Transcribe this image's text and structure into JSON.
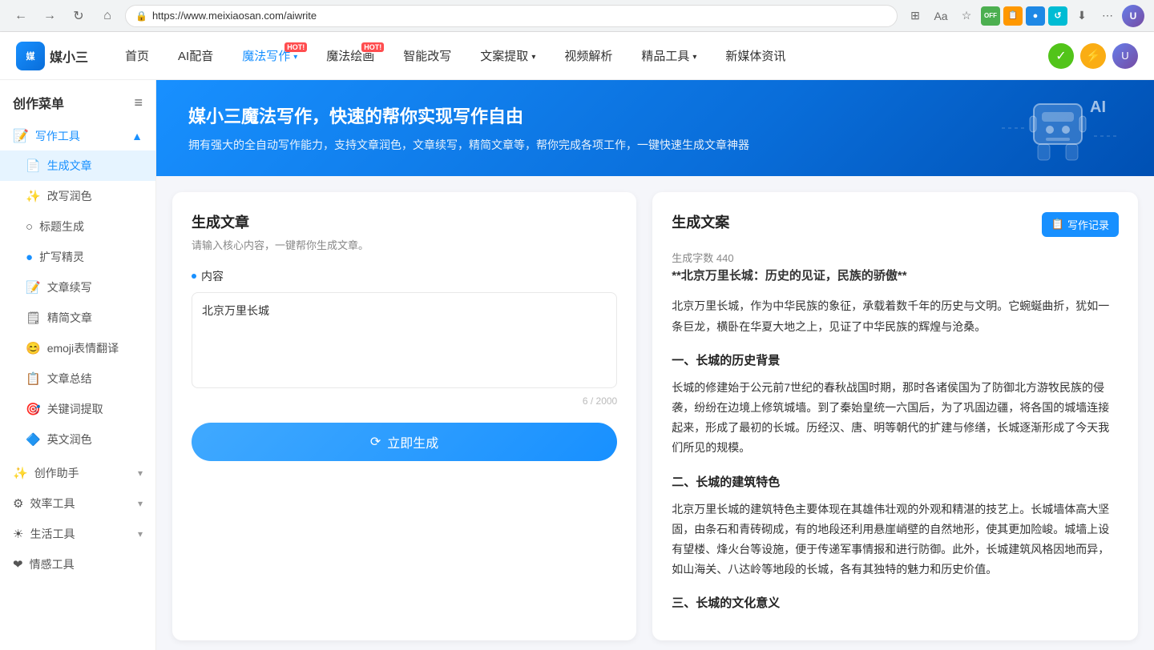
{
  "browser": {
    "url": "https://www.meixiaosan.com/aiwrite",
    "back_label": "←",
    "forward_label": "→",
    "refresh_label": "↻",
    "home_label": "⌂",
    "extensions": [
      {
        "label": "OFF",
        "color": "ext-green"
      },
      {
        "label": "📋",
        "color": "ext-yellow"
      },
      {
        "label": "🔵",
        "color": "ext-blue"
      },
      {
        "label": "🔄",
        "color": "ext-teal"
      },
      {
        "label": "⬇",
        "color": "ext-orange"
      },
      {
        "label": "⋯",
        "color": "ext-purple"
      }
    ],
    "avatar_text": "U"
  },
  "nav": {
    "logo_text": "媒小三",
    "logo_icon_text": "媒",
    "items": [
      {
        "label": "首页",
        "hot": false,
        "has_arrow": false
      },
      {
        "label": "AI配音",
        "hot": false,
        "has_arrow": false
      },
      {
        "label": "魔法写作",
        "hot": true,
        "has_arrow": true
      },
      {
        "label": "魔法绘画",
        "hot": true,
        "has_arrow": false
      },
      {
        "label": "智能改写",
        "hot": false,
        "has_arrow": false
      },
      {
        "label": "文案提取",
        "hot": false,
        "has_arrow": true
      },
      {
        "label": "视频解析",
        "hot": false,
        "has_arrow": false
      },
      {
        "label": "精品工具",
        "hot": false,
        "has_arrow": true
      },
      {
        "label": "新媒体资讯",
        "hot": false,
        "has_arrow": false
      }
    ],
    "hot_label": "HOT"
  },
  "sidebar": {
    "title": "创作菜单",
    "menu_icon": "≡",
    "sections": [
      {
        "id": "writing-tools",
        "title": "写作工具",
        "icon": "📝",
        "expanded": true,
        "items": [
          {
            "id": "generate-article",
            "label": "生成文章",
            "icon": "📄",
            "active": true
          },
          {
            "id": "rewrite-polish",
            "label": "改写润色",
            "icon": "✨"
          },
          {
            "id": "title-generate",
            "label": "标题生成",
            "icon": "○"
          },
          {
            "id": "expand-spirit",
            "label": "扩写精灵",
            "icon": "🔵"
          },
          {
            "id": "article-continue",
            "label": "文章续写",
            "icon": "📝"
          },
          {
            "id": "simplify-article",
            "label": "精简文章",
            "icon": "🗒"
          },
          {
            "id": "emoji-translate",
            "label": "emoji表情翻译",
            "icon": "😊"
          },
          {
            "id": "article-summary",
            "label": "文章总结",
            "icon": "📋"
          },
          {
            "id": "keyword-extract",
            "label": "关键词提取",
            "icon": "🎯"
          },
          {
            "id": "english-polish",
            "label": "英文润色",
            "icon": "🟦"
          }
        ]
      },
      {
        "id": "create-assistant",
        "title": "创作助手",
        "icon": "✨",
        "expanded": false,
        "items": []
      },
      {
        "id": "efficiency-tools",
        "title": "效率工具",
        "icon": "⚙",
        "expanded": false,
        "items": []
      },
      {
        "id": "life-tools",
        "title": "生活工具",
        "icon": "☀",
        "expanded": false,
        "items": []
      },
      {
        "id": "emotion-tools",
        "title": "情感工具",
        "icon": "❤",
        "expanded": false,
        "items": []
      }
    ]
  },
  "banner": {
    "title": "媒小三魔法写作，快速的帮你实现写作自由",
    "subtitle": "拥有强大的全自动写作能力，支持文章润色，文章续写，精简文章等，帮你完成各项工作，一键快速生成文章神器"
  },
  "left_card": {
    "title": "生成文章",
    "subtitle": "请输入核心内容，一键帮你生成文章。",
    "content_label": "内容",
    "content_value": "北京万里长城",
    "char_current": "6",
    "char_max": "2000",
    "generate_btn_label": "立即生成",
    "generate_btn_icon": "↻"
  },
  "right_card": {
    "title": "生成文案",
    "word_count_label": "生成字数",
    "word_count_value": "440",
    "record_btn_icon": "📋",
    "record_btn_label": "写作记录",
    "content": [
      {
        "type": "bold_heading",
        "text": "**北京万里长城：历史的见证，民族的骄傲**"
      },
      {
        "type": "paragraph",
        "text": "北京万里长城，作为中华民族的象征，承载着数千年的历史与文明。它蜿蜒曲折，犹如一条巨龙，横卧在华夏大地之上，见证了中华民族的辉煌与沧桑。"
      },
      {
        "type": "section_heading",
        "text": "一、长城的历史背景"
      },
      {
        "type": "paragraph",
        "text": "长城的修建始于公元前7世纪的春秋战国时期，那时各诸侯国为了防御北方游牧民族的侵袭，纷纷在边境上修筑城墙。到了秦始皇统一六国后，为了巩固边疆，将各国的城墙连接起来，形成了最初的长城。历经汉、唐、明等朝代的扩建与修缮，长城逐渐形成了今天我们所见的规模。"
      },
      {
        "type": "section_heading",
        "text": "二、长城的建筑特色"
      },
      {
        "type": "paragraph",
        "text": "北京万里长城的建筑特色主要体现在其雄伟壮观的外观和精湛的技艺上。长城墙体高大坚固，由条石和青砖砌成，有的地段还利用悬崖峭壁的自然地形，使其更加险峻。城墙上设有望楼、烽火台等设施，便于传递军事情报和进行防御。此外，长城建筑风格因地而异，如山海关、八达岭等地段的长城，各有其独特的魅力和历史价值。"
      },
      {
        "type": "section_heading",
        "text": "三、长城的文化意义"
      }
    ]
  }
}
